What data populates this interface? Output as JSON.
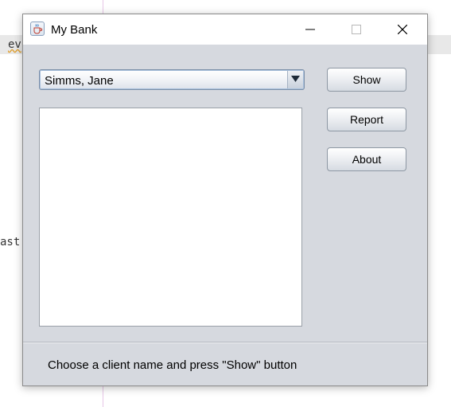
{
  "background": {
    "code_line_1": "ev",
    "code_line_2": "ast"
  },
  "window": {
    "title": "My Bank",
    "icon": "java-cup-icon",
    "controls": {
      "minimize": "minimize-icon",
      "maximize": "maximize-icon",
      "close": "close-icon"
    }
  },
  "client_select": {
    "selected": "Simms, Jane",
    "arrow_icon": "triangle-down-icon"
  },
  "buttons": {
    "show_label": "Show",
    "report_label": "Report",
    "about_label": "About"
  },
  "status": {
    "message": "Choose a client name and press \"Show\" button"
  },
  "colors": {
    "window_bg": "#d6d9df",
    "titlebar_bg": "#ffffff",
    "list_bg": "#ffffff",
    "combo_focus": "#a9c0dc"
  }
}
